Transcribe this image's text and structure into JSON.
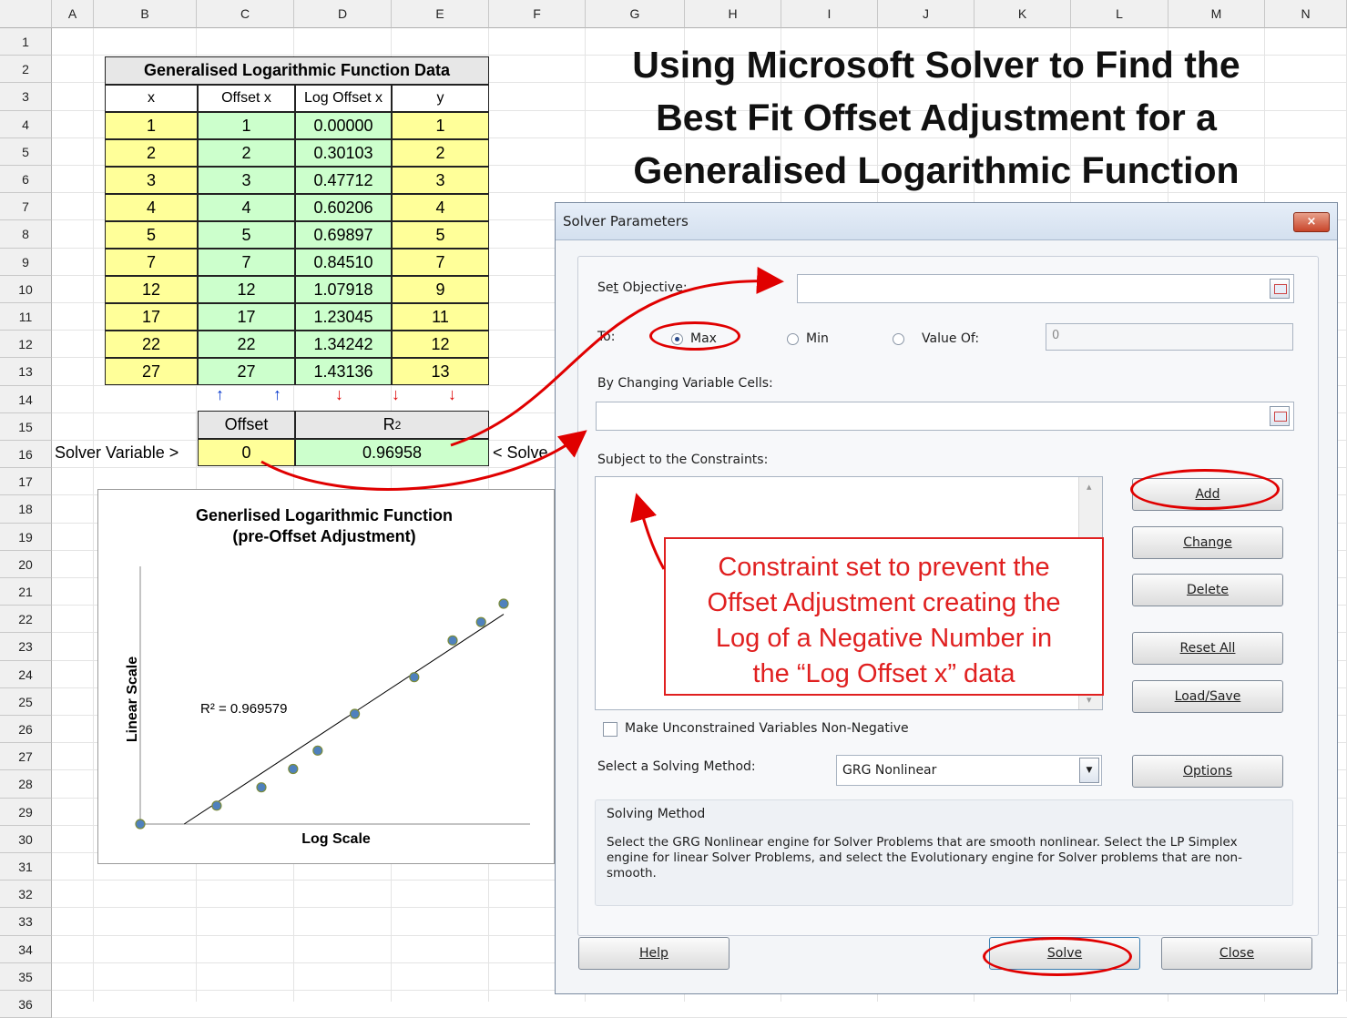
{
  "sheet": {
    "columns": [
      "A",
      "B",
      "C",
      "D",
      "E",
      "F",
      "G",
      "H",
      "I",
      "J",
      "K",
      "L",
      "M",
      "N"
    ],
    "rows": [
      "1",
      "2",
      "3",
      "4",
      "5",
      "6",
      "7",
      "8",
      "9",
      "10",
      "11",
      "12",
      "13",
      "14",
      "15",
      "16",
      "17",
      "18",
      "19",
      "20",
      "21",
      "22",
      "23",
      "24",
      "25",
      "26",
      "27",
      "28",
      "29",
      "30",
      "31",
      "32",
      "33",
      "34",
      "35",
      "36"
    ]
  },
  "data_table": {
    "title": "Generalised Logarithmic Function Data",
    "headers": [
      "x",
      "Offset x",
      "Log Offset x",
      "y"
    ],
    "rows": [
      [
        "1",
        "1",
        "0.00000",
        "1"
      ],
      [
        "2",
        "2",
        "0.30103",
        "2"
      ],
      [
        "3",
        "3",
        "0.47712",
        "3"
      ],
      [
        "4",
        "4",
        "0.60206",
        "4"
      ],
      [
        "5",
        "5",
        "0.69897",
        "5"
      ],
      [
        "7",
        "7",
        "0.84510",
        "7"
      ],
      [
        "12",
        "12",
        "1.07918",
        "9"
      ],
      [
        "17",
        "17",
        "1.23045",
        "11"
      ],
      [
        "22",
        "22",
        "1.34242",
        "12"
      ],
      [
        "27",
        "27",
        "1.43136",
        "13"
      ]
    ],
    "arrows": [
      "↑",
      "↑",
      "↓",
      "↓",
      "↓"
    ],
    "colors": {
      "arrow_up": "#0033cc",
      "arrow_down": "#dd0000",
      "yellow": "#ffff99",
      "green": "#ccffcc"
    }
  },
  "solver_row": {
    "offset_header": "Offset",
    "r2_header": "R",
    "r2_sup": "2",
    "left_label": "Solver Variable >",
    "offset_value": "0",
    "r2_value": "0.96958",
    "right_label": "< Solve"
  },
  "main_title": [
    "Using Microsoft Solver to Find the",
    "Best Fit Offset Adjustment for a",
    "Generalised Logarithmic Function"
  ],
  "chart_data": {
    "type": "scatter",
    "title": "Generlised Logarithmic Function",
    "subtitle": "(pre-Offset Adjustment)",
    "xlabel": "Log Scale",
    "ylabel": "Linear Scale",
    "annotation": "R² = 0.969579",
    "x": [
      0.0,
      0.30103,
      0.47712,
      0.60206,
      0.69897,
      0.8451,
      1.07918,
      1.23045,
      1.34242,
      1.43136
    ],
    "y": [
      1,
      2,
      3,
      4,
      5,
      7,
      9,
      11,
      12,
      13
    ],
    "trendline": true,
    "grid": false,
    "colors": {
      "marker": "#4f81bd",
      "marker_edge": "#7a8a3a",
      "trendline": "#000000"
    }
  },
  "dialog": {
    "title": "Solver Parameters",
    "close": "×",
    "set_objective_pre": "Se",
    "set_objective_u": "t",
    "set_objective_post": " Objective:",
    "to_label": "To:",
    "max_label": "Max",
    "min_label": "Min",
    "valueof_label": "Value Of:",
    "valueof_value": "0",
    "changing_label": "By Changing Variable Cells:",
    "constraints_label": "Subject to the Constraints:",
    "buttons": {
      "add": "Add",
      "change": "Change",
      "delete": "Delete",
      "reset": "Reset All",
      "loadsave": "Load/Save",
      "options": "Options",
      "help": "Help",
      "solve": "Solve",
      "close": "Close"
    },
    "nonneg_label": "Make Unconstrained Variables Non-Negative",
    "method_label": "Select a Solving Method:",
    "method_value": "GRG Nonlinear",
    "method_heading": "Solving Method",
    "method_desc": "Select the GRG Nonlinear engine for Solver Problems that are smooth nonlinear. Select the LP Simplex engine for linear Solver Problems, and select the Evolutionary engine for Solver problems that are non-smooth."
  },
  "annotation": {
    "lines": [
      "Constraint set to prevent the",
      "Offset Adjustment creating the",
      "Log of a Negative Number  in",
      "the “Log Offset x”  data"
    ],
    "color": "#e02020"
  }
}
